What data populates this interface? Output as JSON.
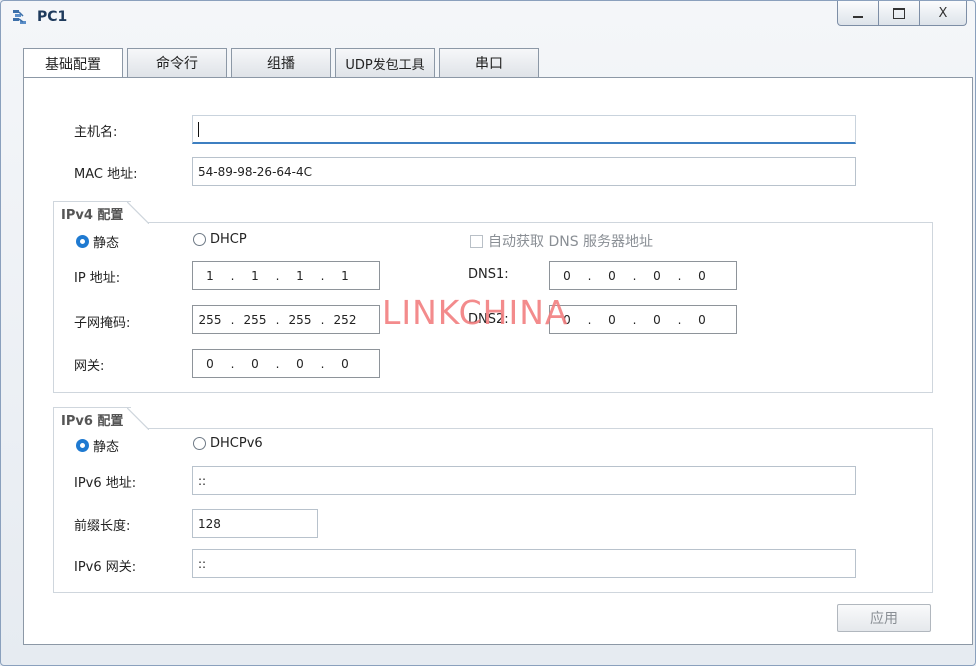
{
  "window": {
    "title": "PC1",
    "buttons": {
      "minimize": "—",
      "maximize": "☐",
      "close": "X"
    }
  },
  "tabs": [
    {
      "label": "基础配置",
      "active": true
    },
    {
      "label": "命令行",
      "active": false
    },
    {
      "label": "组播",
      "active": false
    },
    {
      "label": "UDP发包工具",
      "active": false
    },
    {
      "label": "串口",
      "active": false
    }
  ],
  "basic": {
    "hostname_label": "主机名:",
    "hostname_value": "",
    "mac_label": "MAC 地址:",
    "mac_value": "54-89-98-26-64-4C"
  },
  "ipv4": {
    "group_title": "IPv4 配置",
    "static_label": "静态",
    "dhcp_label": "DHCP",
    "static_selected": true,
    "auto_dns_label": "自动获取 DNS 服务器地址",
    "ip_label": "IP 地址:",
    "ip": [
      "1",
      "1",
      "1",
      "1"
    ],
    "mask_label": "子网掩码:",
    "mask": [
      "255",
      "255",
      "255",
      "252"
    ],
    "gateway_label": "网关:",
    "gateway": [
      "0",
      "0",
      "0",
      "0"
    ],
    "dns1_label": "DNS1:",
    "dns1": [
      "0",
      "0",
      "0",
      "0"
    ],
    "dns2_label": "DNS2:",
    "dns2": [
      "0",
      "0",
      "0",
      "0"
    ]
  },
  "ipv6": {
    "group_title": "IPv6 配置",
    "static_label": "静态",
    "dhcp_label": "DHCPv6",
    "static_selected": true,
    "addr_label": "IPv6 地址:",
    "addr_value": "::",
    "prefix_label": "前缀长度:",
    "prefix_value": "128",
    "gateway_label": "IPv6 网关:",
    "gateway_value": "::"
  },
  "watermark": "LINKCHINA",
  "apply_label": "应用",
  "colors": {
    "accent": "#1f7ad1",
    "watermark": "#f27f80"
  }
}
